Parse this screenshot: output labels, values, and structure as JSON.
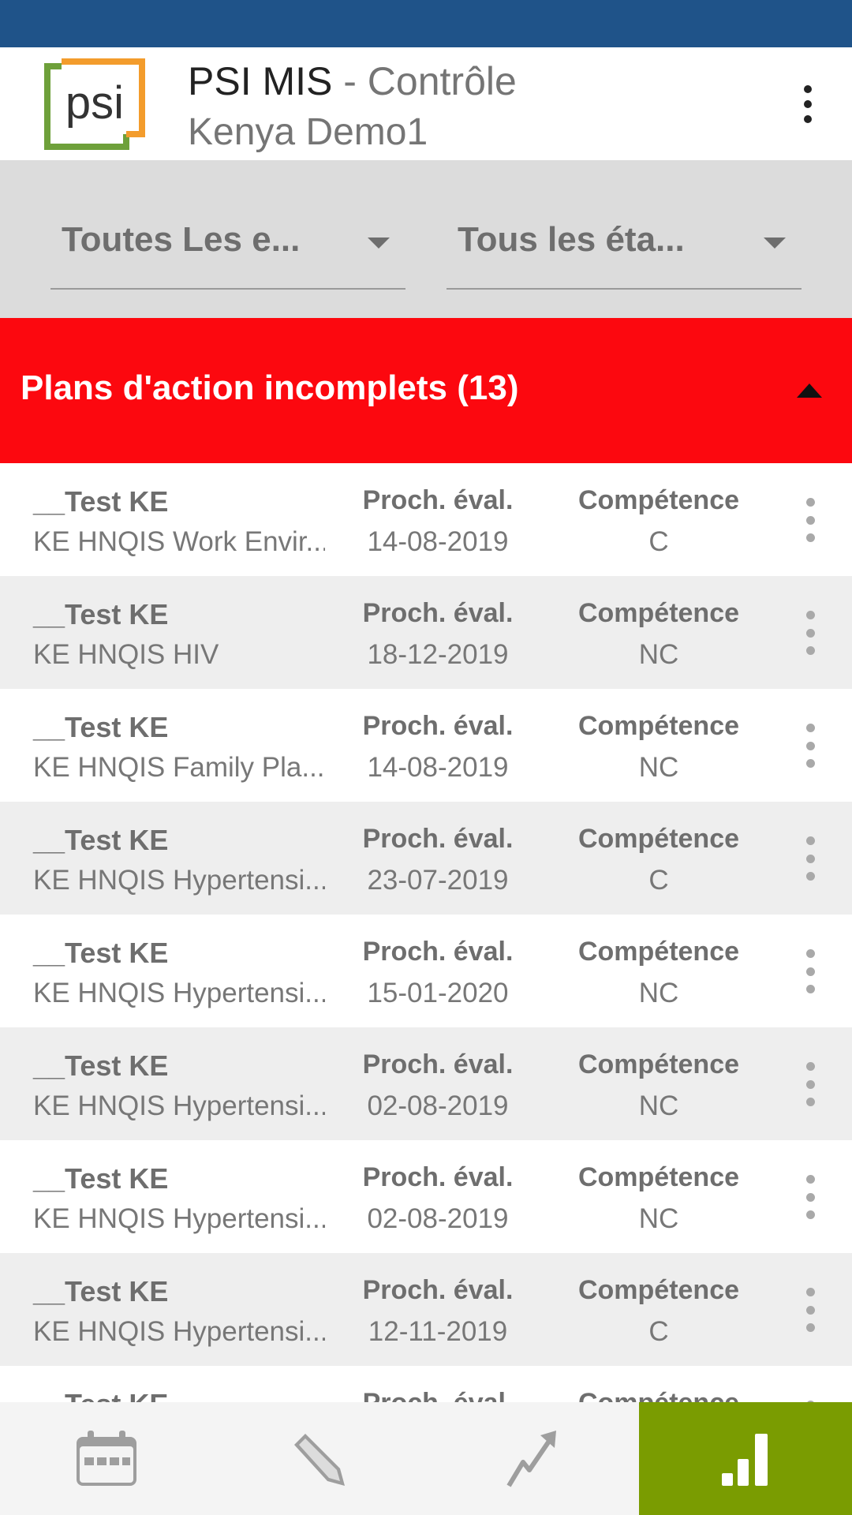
{
  "app": {
    "title": "PSI MIS",
    "module": " - Contrôle",
    "subtitle": "Kenya Demo1",
    "logo_text": "psi",
    "menu_icon": "more-vert-icon"
  },
  "filters": {
    "organisation": "Toutes Les e...",
    "status": "Tous les éta..."
  },
  "section": {
    "title": "Plans d'action incomplets (13)",
    "color": "#fc080f"
  },
  "rows": [
    {
      "org": "__Test KE",
      "program": "KE HNQIS Work Envir...",
      "next_label": "Proch. éval.",
      "next_date": "14-08-2019",
      "comp_label": "Compétence",
      "comp_value": "C"
    },
    {
      "org": "__Test KE",
      "program": "KE HNQIS HIV",
      "next_label": "Proch. éval.",
      "next_date": "18-12-2019",
      "comp_label": "Compétence",
      "comp_value": "NC"
    },
    {
      "org": "__Test KE",
      "program": "KE HNQIS Family Pla...",
      "next_label": "Proch. éval.",
      "next_date": "14-08-2019",
      "comp_label": "Compétence",
      "comp_value": "NC"
    },
    {
      "org": "__Test KE",
      "program": "KE HNQIS Hypertensi...",
      "next_label": "Proch. éval.",
      "next_date": "23-07-2019",
      "comp_label": "Compétence",
      "comp_value": "C"
    },
    {
      "org": "__Test KE",
      "program": "KE HNQIS Hypertensi...",
      "next_label": "Proch. éval.",
      "next_date": "15-01-2020",
      "comp_label": "Compétence",
      "comp_value": "NC"
    },
    {
      "org": "__Test KE",
      "program": "KE HNQIS Hypertensi...",
      "next_label": "Proch. éval.",
      "next_date": "02-08-2019",
      "comp_label": "Compétence",
      "comp_value": "NC"
    },
    {
      "org": "__Test KE",
      "program": "KE HNQIS Hypertensi...",
      "next_label": "Proch. éval.",
      "next_date": "02-08-2019",
      "comp_label": "Compétence",
      "comp_value": "NC"
    },
    {
      "org": "__Test KE",
      "program": "KE HNQIS Hypertensi...",
      "next_label": "Proch. éval.",
      "next_date": "12-11-2019",
      "comp_label": "Compétence",
      "comp_value": "C"
    },
    {
      "org": "__Test KE",
      "program": "",
      "next_label": "Proch. éval.",
      "next_date": "",
      "comp_label": "Compétence",
      "comp_value": ""
    }
  ],
  "bottom_nav": [
    {
      "icon": "calendar-icon",
      "active": false
    },
    {
      "icon": "pencil-icon",
      "active": false
    },
    {
      "icon": "trend-up-icon",
      "active": false
    },
    {
      "icon": "bar-chart-icon",
      "active": true
    }
  ],
  "colors": {
    "status_bar": "#1f5389",
    "nav_active": "#7a9c01",
    "logo_green": "#6ea03a",
    "logo_orange": "#f39c2c"
  }
}
